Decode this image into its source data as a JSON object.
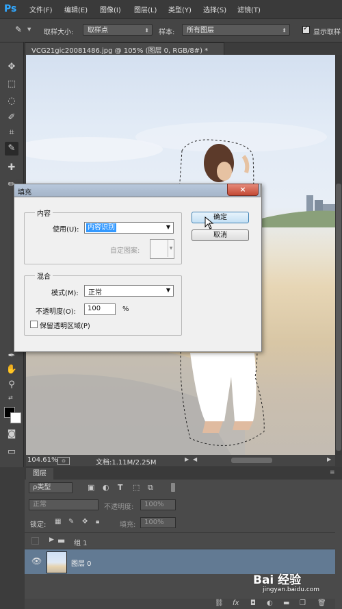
{
  "menubar": {
    "logo": "Ps",
    "items": [
      "文件(F)",
      "编辑(E)",
      "图像(I)",
      "图层(L)",
      "类型(Y)",
      "选择(S)",
      "滤镜(T)"
    ]
  },
  "options": {
    "sample_size_label": "取样大小:",
    "sample_size_value": "取样点",
    "sample_label": "样本:",
    "sample_value": "所有图层",
    "show_ring_label": "显示取样"
  },
  "document": {
    "tab_title": "VCG21gic20081486.jpg @ 105% (图层 0, RGB/8#) *",
    "zoom": "104.61%",
    "doc_info": "文档:1.11M/2.25M"
  },
  "fill_dialog": {
    "title": "填充",
    "close": "×",
    "content_group": "内容",
    "use_label": "使用(U):",
    "use_value": "内容识别",
    "custom_pattern_label": "自定图案:",
    "blend_group": "混合",
    "mode_label": "模式(M):",
    "mode_value": "正常",
    "opacity_label": "不透明度(O):",
    "opacity_value": "100",
    "opacity_unit": "%",
    "preserve_label": "保留透明区域(P)",
    "ok": "确定",
    "cancel": "取消"
  },
  "layers": {
    "tab": "图层",
    "filter_kind": "ρ类型",
    "blend_mode": "正常",
    "opacity_label": "不透明度:",
    "opacity_value": "100%",
    "lock_label": "锁定:",
    "fill_label": "填充:",
    "fill_value": "100%",
    "rows": [
      {
        "name": "组 1"
      },
      {
        "name": "图层 0"
      }
    ]
  },
  "watermark": {
    "brand": "Bai 经验",
    "url": "jingyan.baidu.com"
  }
}
